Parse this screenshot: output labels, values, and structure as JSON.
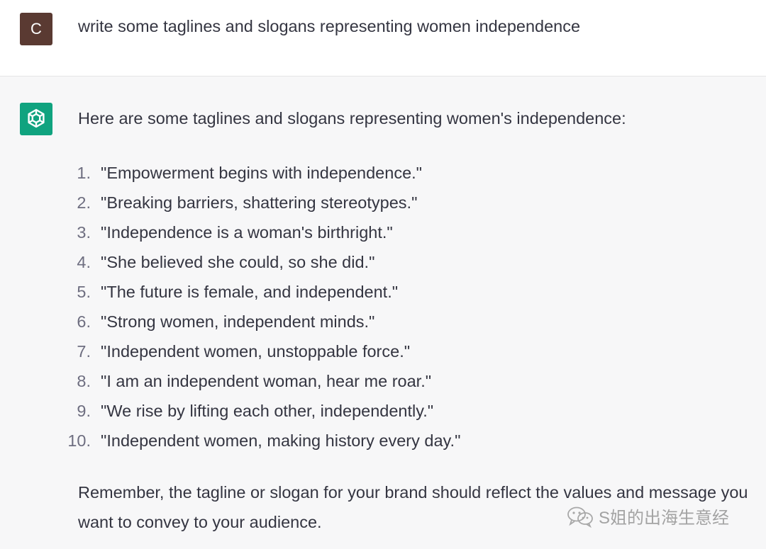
{
  "user_turn": {
    "avatar_letter": "C",
    "message": "write some taglines and slogans representing women independence"
  },
  "assistant_turn": {
    "intro": "Here are some taglines and slogans representing women's independence:",
    "items": [
      {
        "num": "1.",
        "text": "\"Empowerment begins with independence.\""
      },
      {
        "num": "2.",
        "text": "\"Breaking barriers, shattering stereotypes.\""
      },
      {
        "num": "3.",
        "text": "\"Independence is a woman's birthright.\""
      },
      {
        "num": "4.",
        "text": "\"She believed she could, so she did.\""
      },
      {
        "num": "5.",
        "text": "\"The future is female, and independent.\""
      },
      {
        "num": "6.",
        "text": "\"Strong women, independent minds.\""
      },
      {
        "num": "7.",
        "text": "\"Independent women, unstoppable force.\""
      },
      {
        "num": "8.",
        "text": "\"I am an independent woman, hear me roar.\""
      },
      {
        "num": "9.",
        "text": "\"We rise by lifting each other, independently.\""
      },
      {
        "num": "10.",
        "text": "\"Independent women, making history every day.\""
      }
    ],
    "outro": "Remember, the tagline or slogan for your brand should reflect the values and message you want to convey to your audience."
  },
  "watermark": {
    "icon": "wechat-icon",
    "text": "S姐的出海生意经"
  },
  "colors": {
    "user_avatar": "#5a3a32",
    "assistant_avatar": "#10a37f",
    "assistant_bg": "#f7f7f8",
    "text": "#343541"
  }
}
